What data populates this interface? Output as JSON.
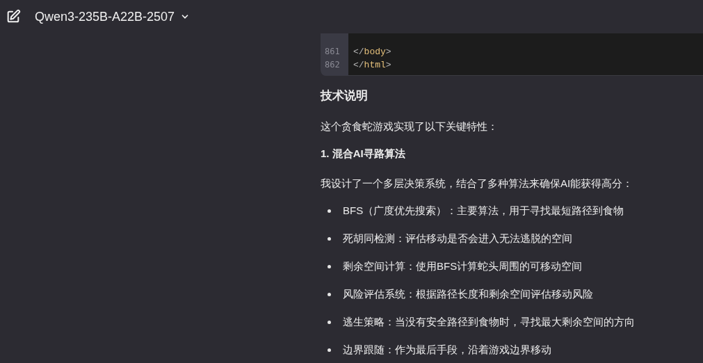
{
  "header": {
    "model_name": "Qwen3-235B-A22B-2507"
  },
  "code_block": {
    "lines": [
      {
        "number": "861",
        "tokens": [
          {
            "kind": "punct",
            "text": "</"
          },
          {
            "kind": "tag",
            "text": "body"
          },
          {
            "kind": "punct",
            "text": ">"
          }
        ]
      },
      {
        "number": "862",
        "tokens": [
          {
            "kind": "punct",
            "text": "</"
          },
          {
            "kind": "tag",
            "text": "html"
          },
          {
            "kind": "punct",
            "text": ">"
          }
        ]
      }
    ]
  },
  "content": [
    {
      "kind": "heading",
      "text": "技术说明"
    },
    {
      "kind": "paragraph",
      "text": "这个贪食蛇游戏实现了以下关键特性："
    },
    {
      "kind": "subheading",
      "text": "1. 混合AI寻路算法"
    },
    {
      "kind": "paragraph",
      "text": "我设计了一个多层决策系统，结合了多种算法来确保AI能获得高分："
    },
    {
      "kind": "list",
      "items": [
        "BFS（广度优先搜索）：主要算法，用于寻找最短路径到食物",
        "死胡同检测：评估移动是否会进入无法逃脱的空间",
        "剩余空间计算：使用BFS计算蛇头周围的可移动空间",
        "风险评估系统：根据路径长度和剩余空间评估移动风险",
        "逃生策略：当没有安全路径到食物时，寻找最大剩余空间的方向",
        "边界跟随：作为最后手段，沿着游戏边界移动"
      ]
    }
  ]
}
